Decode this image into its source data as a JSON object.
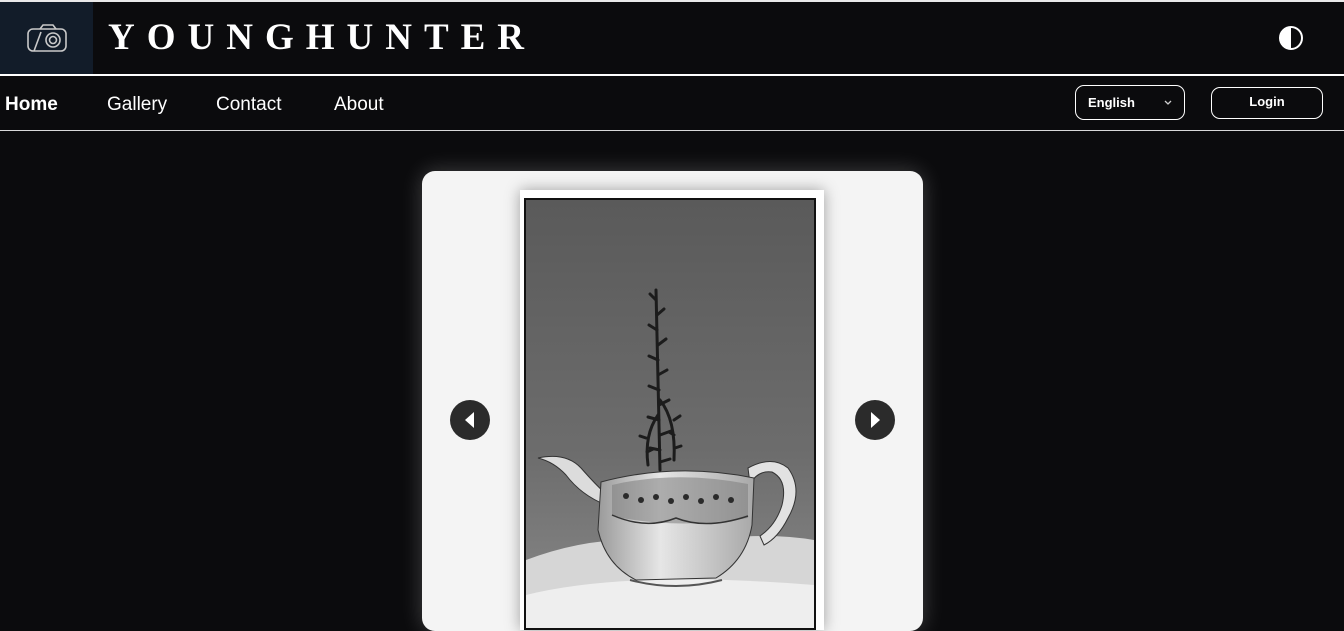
{
  "header": {
    "brand": "YOUNGHUNTER",
    "logo_icon": "camera-icon",
    "theme_icon": "contrast-toggle-icon"
  },
  "nav": {
    "items": [
      {
        "label": "Home",
        "active": true
      },
      {
        "label": "Gallery",
        "active": false
      },
      {
        "label": "Contact",
        "active": false
      },
      {
        "label": "About",
        "active": false
      }
    ],
    "language": {
      "selected": "English",
      "icon": "chevron-down-icon"
    },
    "login_label": "Login"
  },
  "carousel": {
    "prev_icon": "arrow-left-icon",
    "next_icon": "arrow-right-icon",
    "photo_subject": "teapot-with-succulent-bw-photo"
  },
  "colors": {
    "background": "#0b0b0d",
    "logo_box": "#121c29",
    "card": "#f4f4f4",
    "arrow": "#2b2b2b",
    "text": "#ffffff"
  }
}
